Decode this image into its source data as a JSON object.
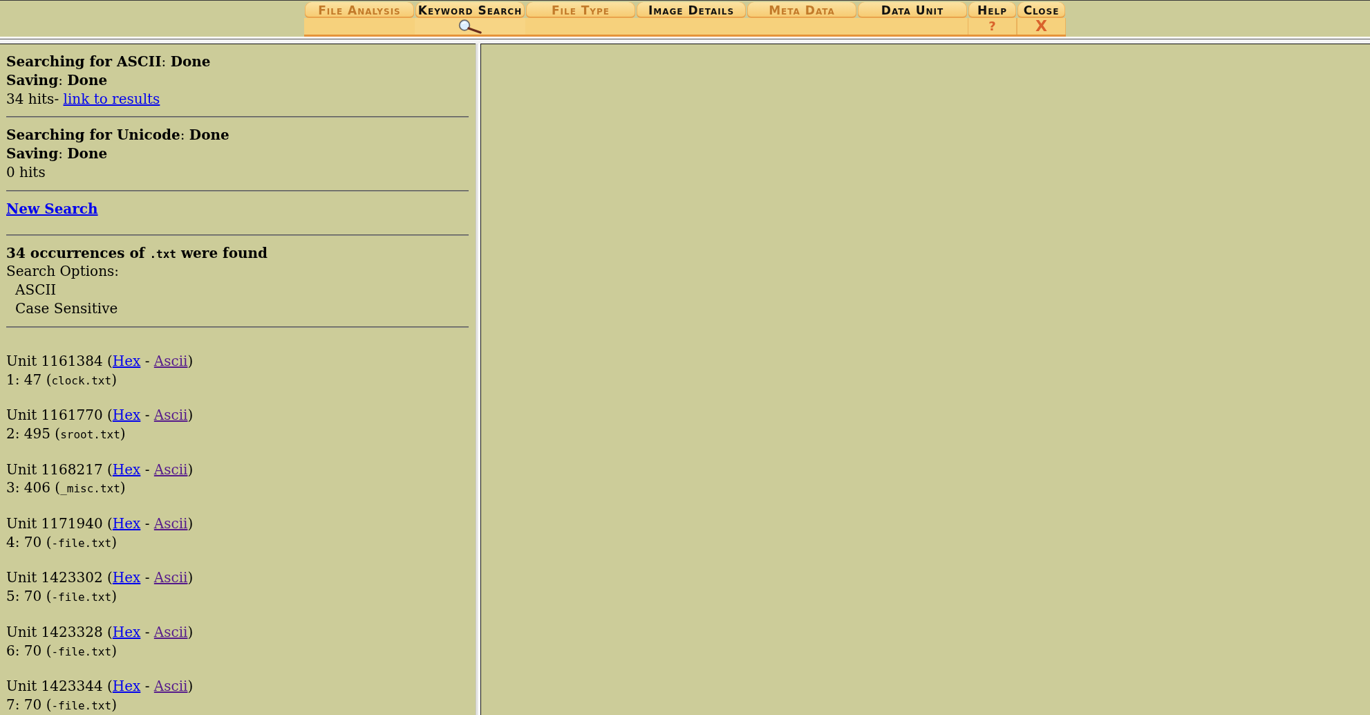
{
  "toolbar": {
    "tabs": [
      {
        "label": "File Analysis",
        "selected": false,
        "disabled": true
      },
      {
        "label": "Keyword Search",
        "selected": true,
        "disabled": false
      },
      {
        "label": "File Type",
        "selected": false,
        "disabled": true
      },
      {
        "label": "Image Details",
        "selected": false,
        "disabled": false
      },
      {
        "label": "Meta Data",
        "selected": false,
        "disabled": true
      },
      {
        "label": "Data Unit",
        "selected": false,
        "disabled": false
      }
    ],
    "buttons": [
      {
        "kind": "help",
        "label": "Help",
        "glyph": "?"
      },
      {
        "kind": "close",
        "label": "Close",
        "glyph": "X"
      }
    ]
  },
  "results_panel": {
    "status_blocks": [
      {
        "search_line": "**Searching for ASCII**: **Done**",
        "saving_line": "**Saving**: **Done**",
        "hits": "34 hits-",
        "link": "link to results"
      },
      {
        "search_line": "**Searching for Unicode**: **Done**",
        "saving_line": "**Saving**: **Done**",
        "hits": "0 hits"
      }
    ],
    "new_search_link": "New Search",
    "summary": {
      "heading": [
        {
          "kind": "text",
          "text": "34 occurrences of "
        },
        {
          "kind": "code",
          "text": ".txt"
        },
        {
          "kind": "text",
          "text": " were found"
        }
      ],
      "options_label": "Search Options:",
      "options": [
        "ASCII",
        "Case Sensitive"
      ]
    },
    "units": [
      {
        "unit_line": [
          {
            "kind": "text",
            "text": "Unit 1161384 ("
          },
          {
            "kind": "link",
            "text": "Hex",
            "visited": false
          },
          {
            "kind": "text",
            "text": " - "
          },
          {
            "kind": "link",
            "text": "Ascii",
            "visited": true
          },
          {
            "kind": "text",
            "text": ")"
          }
        ],
        "hit_line": [
          {
            "kind": "text",
            "text": "1: 47 ("
          },
          {
            "kind": "code",
            "text": "clock.txt"
          },
          {
            "kind": "text",
            "text": ")"
          }
        ]
      },
      {
        "unit_line": [
          {
            "kind": "text",
            "text": "Unit 1161770 ("
          },
          {
            "kind": "link",
            "text": "Hex",
            "visited": false
          },
          {
            "kind": "text",
            "text": " - "
          },
          {
            "kind": "link",
            "text": "Ascii",
            "visited": true
          },
          {
            "kind": "text",
            "text": ")"
          }
        ],
        "hit_line": [
          {
            "kind": "text",
            "text": "2: 495 ("
          },
          {
            "kind": "code",
            "text": "sroot.txt"
          },
          {
            "kind": "text",
            "text": ")"
          }
        ]
      },
      {
        "unit_line": [
          {
            "kind": "text",
            "text": "Unit 1168217 ("
          },
          {
            "kind": "link",
            "text": "Hex",
            "visited": false
          },
          {
            "kind": "text",
            "text": " - "
          },
          {
            "kind": "link",
            "text": "Ascii",
            "visited": true
          },
          {
            "kind": "text",
            "text": ")"
          }
        ],
        "hit_line": [
          {
            "kind": "text",
            "text": "3: 406 ("
          },
          {
            "kind": "code",
            "text": "_misc.txt"
          },
          {
            "kind": "text",
            "text": ")"
          }
        ]
      },
      {
        "unit_line": [
          {
            "kind": "text",
            "text": "Unit 1171940 ("
          },
          {
            "kind": "link",
            "text": "Hex",
            "visited": false
          },
          {
            "kind": "text",
            "text": " - "
          },
          {
            "kind": "link",
            "text": "Ascii",
            "visited": true
          },
          {
            "kind": "text",
            "text": ")"
          }
        ],
        "hit_line": [
          {
            "kind": "text",
            "text": "4: 70 ("
          },
          {
            "kind": "code",
            "text": "-file.txt"
          },
          {
            "kind": "text",
            "text": ")"
          }
        ]
      },
      {
        "unit_line": [
          {
            "kind": "text",
            "text": "Unit 1423302 ("
          },
          {
            "kind": "link",
            "text": "Hex",
            "visited": false
          },
          {
            "kind": "text",
            "text": " - "
          },
          {
            "kind": "link",
            "text": "Ascii",
            "visited": true
          },
          {
            "kind": "text",
            "text": ")"
          }
        ],
        "hit_line": [
          {
            "kind": "text",
            "text": "5: 70 ("
          },
          {
            "kind": "code",
            "text": "-file.txt"
          },
          {
            "kind": "text",
            "text": ")"
          }
        ]
      },
      {
        "unit_line": [
          {
            "kind": "text",
            "text": "Unit 1423328 ("
          },
          {
            "kind": "link",
            "text": "Hex",
            "visited": false
          },
          {
            "kind": "text",
            "text": " - "
          },
          {
            "kind": "link",
            "text": "Ascii",
            "visited": true
          },
          {
            "kind": "text",
            "text": ")"
          }
        ],
        "hit_line": [
          {
            "kind": "text",
            "text": "6: 70 ("
          },
          {
            "kind": "code",
            "text": "-file.txt"
          },
          {
            "kind": "text",
            "text": ")"
          }
        ]
      },
      {
        "unit_line": [
          {
            "kind": "text",
            "text": "Unit 1423344 ("
          },
          {
            "kind": "link",
            "text": "Hex",
            "visited": false
          },
          {
            "kind": "text",
            "text": " - "
          },
          {
            "kind": "link",
            "text": "Ascii",
            "visited": true
          },
          {
            "kind": "text",
            "text": ")"
          }
        ],
        "hit_line": [
          {
            "kind": "text",
            "text": "7: 70 ("
          },
          {
            "kind": "code",
            "text": "-file.txt"
          },
          {
            "kind": "text",
            "text": ")"
          }
        ]
      }
    ]
  }
}
